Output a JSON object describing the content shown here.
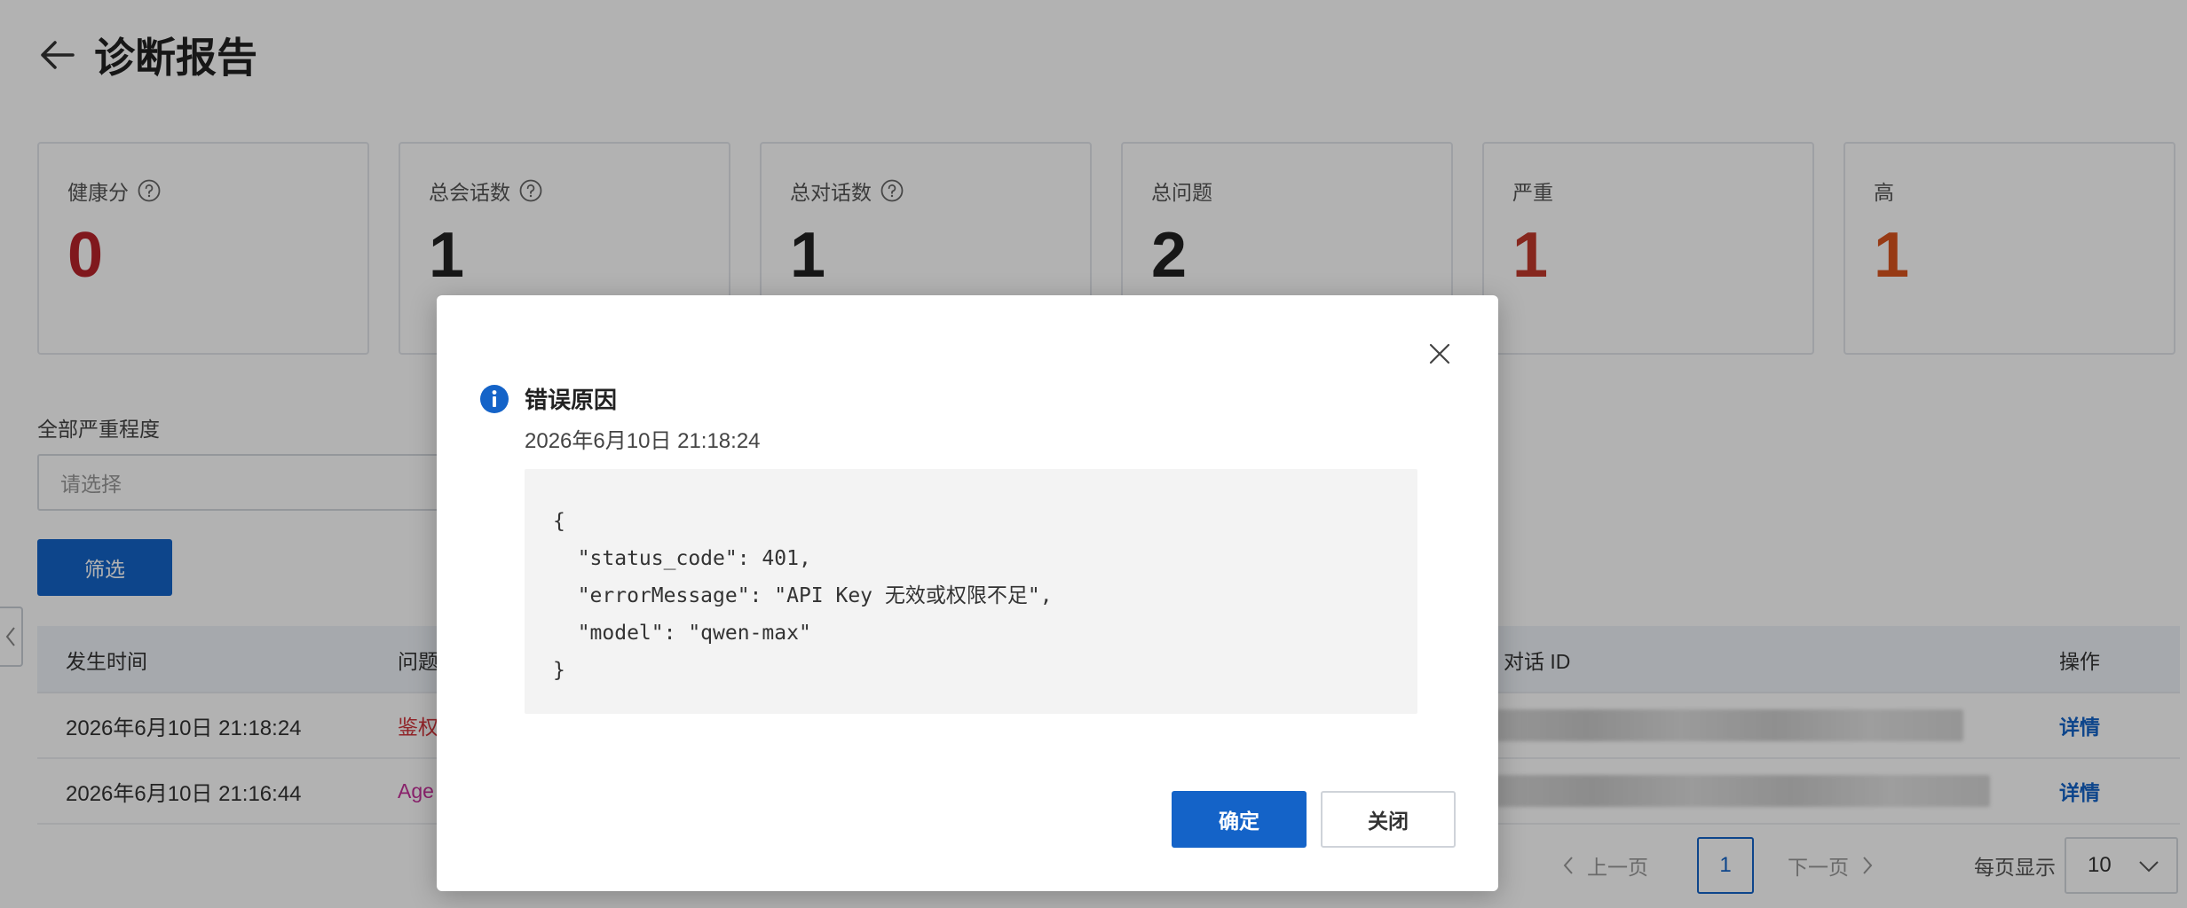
{
  "header": {
    "title": "诊断报告",
    "back_icon": "arrow-left-icon"
  },
  "stats": [
    {
      "label": "健康分",
      "value": "0",
      "has_help": true,
      "color": "#b8232a"
    },
    {
      "label": "总会话数",
      "value": "1",
      "has_help": true,
      "color": "#222222"
    },
    {
      "label": "总对话数",
      "value": "1",
      "has_help": true,
      "color": "#222222"
    },
    {
      "label": "总问题",
      "value": "2",
      "has_help": false,
      "color": "#222222"
    },
    {
      "label": "严重",
      "value": "1",
      "has_help": false,
      "color": "#c0392b"
    },
    {
      "label": "高",
      "value": "1",
      "has_help": false,
      "color": "#d9531e"
    }
  ],
  "filter": {
    "label": "全部严重程度",
    "placeholder": "请选择",
    "button": "筛选"
  },
  "table": {
    "headers": {
      "time": "发生时间",
      "issue": "问题",
      "dialog_id": "对话 ID",
      "action": "操作"
    },
    "rows": [
      {
        "time": "2026年6月10日 21:18:24",
        "issue": "鉴权",
        "issue_color": "#d0343a",
        "action": "详情"
      },
      {
        "time": "2026年6月10日 21:16:44",
        "issue": "Age",
        "issue_color": "#c4309a",
        "action": "详情"
      }
    ]
  },
  "pagination": {
    "prev": "上一页",
    "current": "1",
    "next": "下一页",
    "page_size_label": "每页显示",
    "page_size": "10"
  },
  "modal": {
    "title": "错误原因",
    "time": "2026年6月10日 21:18:24",
    "code_lines": [
      "{",
      "  \"status_code\": 401,",
      "  \"errorMessage\": \"API Key 无效或权限不足\",",
      "  \"model\": \"qwen-max\"",
      "}"
    ],
    "confirm": "确定",
    "close": "关闭"
  },
  "colors": {
    "primary": "#1463c8",
    "danger": "#b8232a",
    "info": "#1463c8"
  }
}
